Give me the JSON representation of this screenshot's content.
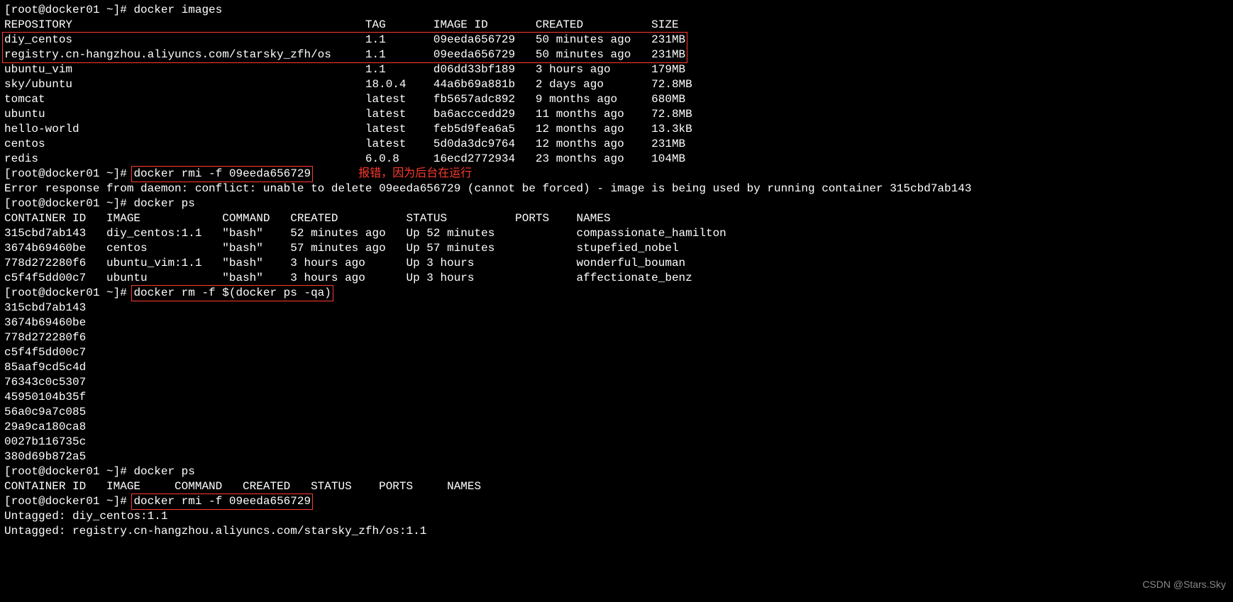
{
  "prompt": "[root@docker01 ~]# ",
  "cmd1": "docker images",
  "images_header": {
    "repo": "REPOSITORY",
    "tag": "TAG",
    "id": "IMAGE ID",
    "created": "CREATED",
    "size": "SIZE"
  },
  "images": [
    {
      "repo": "diy_centos",
      "tag": "1.1",
      "id": "09eeda656729",
      "created": "50 minutes ago",
      "size": "231MB"
    },
    {
      "repo": "registry.cn-hangzhou.aliyuncs.com/starsky_zfh/os",
      "tag": "1.1",
      "id": "09eeda656729",
      "created": "50 minutes ago",
      "size": "231MB"
    },
    {
      "repo": "ubuntu_vim",
      "tag": "1.1",
      "id": "d06dd33bf189",
      "created": "3 hours ago",
      "size": "179MB"
    },
    {
      "repo": "sky/ubuntu",
      "tag": "18.0.4",
      "id": "44a6b69a881b",
      "created": "2 days ago",
      "size": "72.8MB"
    },
    {
      "repo": "tomcat",
      "tag": "latest",
      "id": "fb5657adc892",
      "created": "9 months ago",
      "size": "680MB"
    },
    {
      "repo": "ubuntu",
      "tag": "latest",
      "id": "ba6acccedd29",
      "created": "11 months ago",
      "size": "72.8MB"
    },
    {
      "repo": "hello-world",
      "tag": "latest",
      "id": "feb5d9fea6a5",
      "created": "12 months ago",
      "size": "13.3kB"
    },
    {
      "repo": "centos",
      "tag": "latest",
      "id": "5d0da3dc9764",
      "created": "12 months ago",
      "size": "231MB"
    },
    {
      "repo": "redis",
      "tag": "6.0.8",
      "id": "16ecd2772934",
      "created": "23 months ago",
      "size": "104MB"
    }
  ],
  "cmd2": "docker rmi -f 09eeda656729",
  "annotation1": "报错，因为后台在运行",
  "error_line": "Error response from daemon: conflict: unable to delete 09eeda656729 (cannot be forced) - image is being used by running container 315cbd7ab143",
  "cmd3": "docker ps",
  "ps_header": {
    "cid": "CONTAINER ID",
    "image": "IMAGE",
    "command": "COMMAND",
    "created": "CREATED",
    "status": "STATUS",
    "ports": "PORTS",
    "names": "NAMES"
  },
  "ps_rows": [
    {
      "cid": "315cbd7ab143",
      "image": "diy_centos:1.1",
      "command": "\"bash\"",
      "created": "52 minutes ago",
      "status": "Up 52 minutes",
      "ports": "",
      "names": "compassionate_hamilton"
    },
    {
      "cid": "3674b69460be",
      "image": "centos",
      "command": "\"bash\"",
      "created": "57 minutes ago",
      "status": "Up 57 minutes",
      "ports": "",
      "names": "stupefied_nobel"
    },
    {
      "cid": "778d272280f6",
      "image": "ubuntu_vim:1.1",
      "command": "\"bash\"",
      "created": "3 hours ago",
      "status": "Up 3 hours",
      "ports": "",
      "names": "wonderful_bouman"
    },
    {
      "cid": "c5f4f5dd00c7",
      "image": "ubuntu",
      "command": "\"bash\"",
      "created": "3 hours ago",
      "status": "Up 3 hours",
      "ports": "",
      "names": "affectionate_benz"
    }
  ],
  "cmd4": "docker rm -f $(docker ps -qa)",
  "removed_ids": [
    "315cbd7ab143",
    "3674b69460be",
    "778d272280f6",
    "c5f4f5dd00c7",
    "85aaf9cd5c4d",
    "76343c0c5307",
    "45950104b35f",
    "56a0c9a7c085",
    "29a9ca180ca8",
    "0027b116735c",
    "380d69b872a5"
  ],
  "cmd5": "docker ps",
  "ps2_header": "CONTAINER ID   IMAGE     COMMAND   CREATED   STATUS    PORTS     NAMES",
  "cmd6": "docker rmi -f 09eeda656729",
  "untagged1": "Untagged: diy_centos:1.1",
  "untagged2": "Untagged: registry.cn-hangzhou.aliyuncs.com/starsky_zfh/os:1.1",
  "watermark": "CSDN @Stars.Sky"
}
